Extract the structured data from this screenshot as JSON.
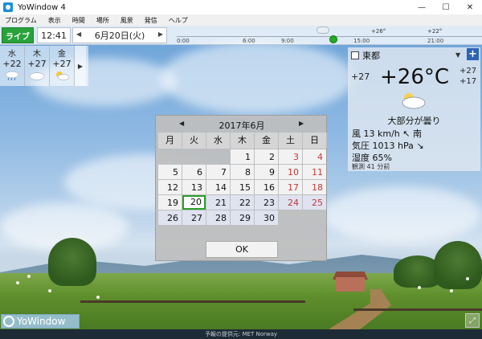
{
  "window": {
    "title": "YoWindow 4",
    "controls": [
      "—",
      "☐",
      "✕"
    ]
  },
  "menu": [
    "プログラム",
    "表示",
    "時間",
    "場所",
    "風景",
    "発信",
    "ヘルプ"
  ],
  "topbar": {
    "live_label": "ライブ",
    "time": "12:41",
    "date": "6月20日(火)",
    "prev_arrow": "◀",
    "next_arrow": "▶",
    "timeline_labels": [
      "0:00",
      "6:00",
      "9:00",
      "15:00",
      "21:00"
    ],
    "timeline_temps": [
      "+26°",
      "+22°"
    ]
  },
  "forecast": {
    "days": [
      {
        "day": "水",
        "temp": "+22",
        "icon": "rain-cloud-icon"
      },
      {
        "day": "木",
        "temp": "+27",
        "icon": "cloud-icon"
      },
      {
        "day": "金",
        "temp": "+27",
        "icon": "sun-cloud-icon"
      }
    ],
    "more_arrow": "▶"
  },
  "weather": {
    "city": "東都",
    "caret": "▼",
    "add": "+",
    "feels_like": "+27",
    "temperature": "+26°C",
    "high": "+27",
    "low": "+17",
    "condition": "大部分が曇り",
    "wind": "風  13 km/h ↖ 南",
    "pressure": "気圧  1013 hPa ↘",
    "humidity": "湿度  65%",
    "observed": "観測 41 分前"
  },
  "calendar": {
    "month_title": "2017年6月",
    "prev": "◀",
    "next": "▶",
    "weekdays": [
      "月",
      "火",
      "水",
      "木",
      "金",
      "土",
      "日"
    ],
    "ok_label": "OK",
    "weeks": [
      [
        "",
        "",
        "",
        "1",
        "2",
        "3",
        "4"
      ],
      [
        "5",
        "6",
        "7",
        "8",
        "9",
        "10",
        "11"
      ],
      [
        "12",
        "13",
        "14",
        "15",
        "16",
        "17",
        "18"
      ],
      [
        "19",
        "20",
        "21",
        "22",
        "23",
        "24",
        "25"
      ],
      [
        "26",
        "27",
        "28",
        "29",
        "30",
        "",
        ""
      ]
    ],
    "selected_day": "20"
  },
  "footer": {
    "logo": "YoWindow",
    "fullscreen_icon": "⤢",
    "credit": "予報の提供元: MET Norway"
  }
}
